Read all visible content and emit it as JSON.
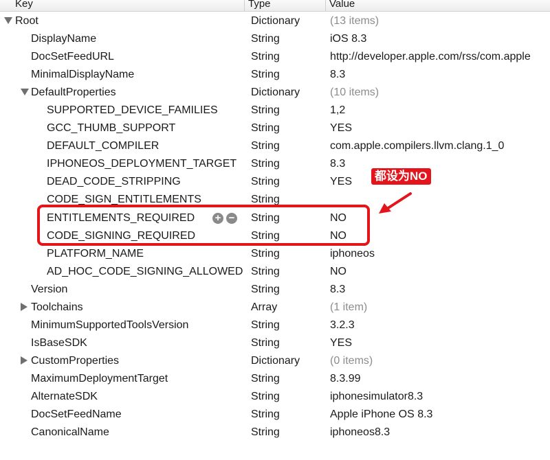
{
  "columns": {
    "key": "Key",
    "type": "Type",
    "value": "Value"
  },
  "rows": [
    {
      "key": "Root",
      "type": "Dictionary",
      "value": "(13 items)",
      "level": 0,
      "disclosure": "open",
      "count": true
    },
    {
      "key": "DisplayName",
      "type": "String",
      "value": "iOS 8.3",
      "level": 1
    },
    {
      "key": "DocSetFeedURL",
      "type": "String",
      "value": "http://developer.apple.com/rss/com.apple",
      "level": 1
    },
    {
      "key": "MinimalDisplayName",
      "type": "String",
      "value": "8.3",
      "level": 1
    },
    {
      "key": "DefaultProperties",
      "type": "Dictionary",
      "value": "(10 items)",
      "level": 1,
      "disclosure": "open",
      "count": true
    },
    {
      "key": "SUPPORTED_DEVICE_FAMILIES",
      "type": "String",
      "value": "1,2",
      "level": 2
    },
    {
      "key": "GCC_THUMB_SUPPORT",
      "type": "String",
      "value": "YES",
      "level": 2
    },
    {
      "key": "DEFAULT_COMPILER",
      "type": "String",
      "value": "com.apple.compilers.llvm.clang.1_0",
      "level": 2
    },
    {
      "key": "IPHONEOS_DEPLOYMENT_TARGET",
      "type": "String",
      "value": "8.3",
      "level": 2
    },
    {
      "key": "DEAD_CODE_STRIPPING",
      "type": "String",
      "value": "YES",
      "level": 2
    },
    {
      "key": "CODE_SIGN_ENTITLEMENTS",
      "type": "String",
      "value": "",
      "level": 2
    },
    {
      "key": "ENTITLEMENTS_REQUIRED",
      "type": "String",
      "value": "NO",
      "level": 2,
      "hover": true
    },
    {
      "key": "CODE_SIGNING_REQUIRED",
      "type": "String",
      "value": "NO",
      "level": 2
    },
    {
      "key": "PLATFORM_NAME",
      "type": "String",
      "value": "iphoneos",
      "level": 2
    },
    {
      "key": "AD_HOC_CODE_SIGNING_ALLOWED",
      "type": "String",
      "value": "NO",
      "level": 2
    },
    {
      "key": "Version",
      "type": "String",
      "value": "8.3",
      "level": 1
    },
    {
      "key": "Toolchains",
      "type": "Array",
      "value": "(1 item)",
      "level": 1,
      "disclosure": "closed",
      "count": true
    },
    {
      "key": "MinimumSupportedToolsVersion",
      "type": "String",
      "value": "3.2.3",
      "level": 1
    },
    {
      "key": "IsBaseSDK",
      "type": "String",
      "value": "YES",
      "level": 1
    },
    {
      "key": "CustomProperties",
      "type": "Dictionary",
      "value": "(0 items)",
      "level": 1,
      "disclosure": "closed",
      "count": true
    },
    {
      "key": "MaximumDeploymentTarget",
      "type": "String",
      "value": "8.3.99",
      "level": 1
    },
    {
      "key": "AlternateSDK",
      "type": "String",
      "value": "iphonesimulator8.3",
      "level": 1
    },
    {
      "key": "DocSetFeedName",
      "type": "String",
      "value": "Apple iPhone OS 8.3",
      "level": 1
    },
    {
      "key": "CanonicalName",
      "type": "String",
      "value": "iphoneos8.3",
      "level": 1
    }
  ],
  "row_buttons": {
    "add": "+",
    "remove": "−"
  },
  "annotation": {
    "text": "都设为NO",
    "color": "#e3141b"
  }
}
